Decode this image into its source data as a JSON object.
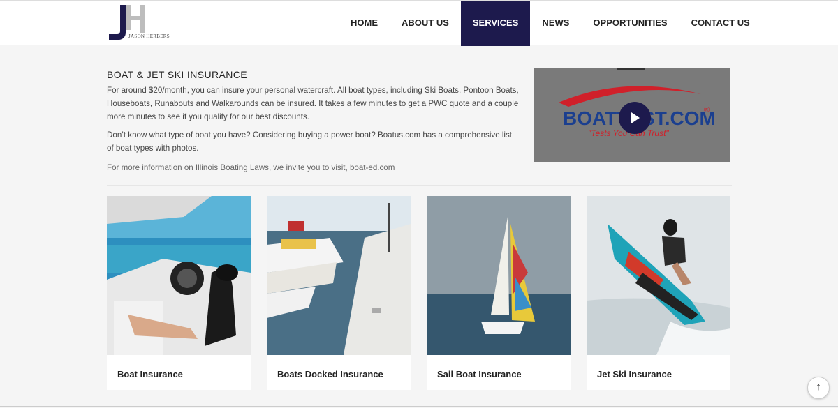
{
  "header": {
    "logo": {
      "initials": "JH",
      "company": "JASON HERBERS"
    },
    "nav": [
      {
        "label": "HOME",
        "active": false
      },
      {
        "label": "ABOUT US",
        "active": false
      },
      {
        "label": "SERVICES",
        "active": true
      },
      {
        "label": "NEWS",
        "active": false
      },
      {
        "label": "OPPORTUNITIES",
        "active": false
      },
      {
        "label": "CONTACT US",
        "active": false
      }
    ]
  },
  "intro": {
    "title": "BOAT & JET SKI INSURANCE",
    "paragraph1": "For around $20/month, you can insure your personal watercraft. All boat types, including Ski Boats, Pontoon Boats, Houseboats, Runabouts and Walkarounds can be insured. It takes a few minutes to get a PWC quote and a couple more minutes to see if you qualify for our best discounts.",
    "paragraph2": "Don’t know what type of boat you have? Considering buying a power boat? Boatus.com has a comprehensive list of boat types with photos.",
    "paragraph3": "For more information on Illinois Boating Laws, we invite you to visit, boat-ed.com"
  },
  "video": {
    "brand": "BOATTEST.COM",
    "tagline": "\"Tests You Can Trust\"",
    "registered": "®"
  },
  "cards": [
    {
      "title": "Boat Insurance",
      "image": "woman-relaxing-on-boat-photo"
    },
    {
      "title": "Boats Docked Insurance",
      "image": "boats-docked-at-pier-photo"
    },
    {
      "title": "Sail Boat Insurance",
      "image": "sailboat-on-lake-photo"
    },
    {
      "title": "Jet Ski Insurance",
      "image": "man-riding-jet-ski-photo"
    }
  ],
  "scroll_top": {
    "glyph": "↑"
  },
  "colors": {
    "accent": "#1d1a4d",
    "background": "#f5f5f5",
    "brand_red": "#d0202a",
    "brand_blue": "#1b3f8f"
  }
}
